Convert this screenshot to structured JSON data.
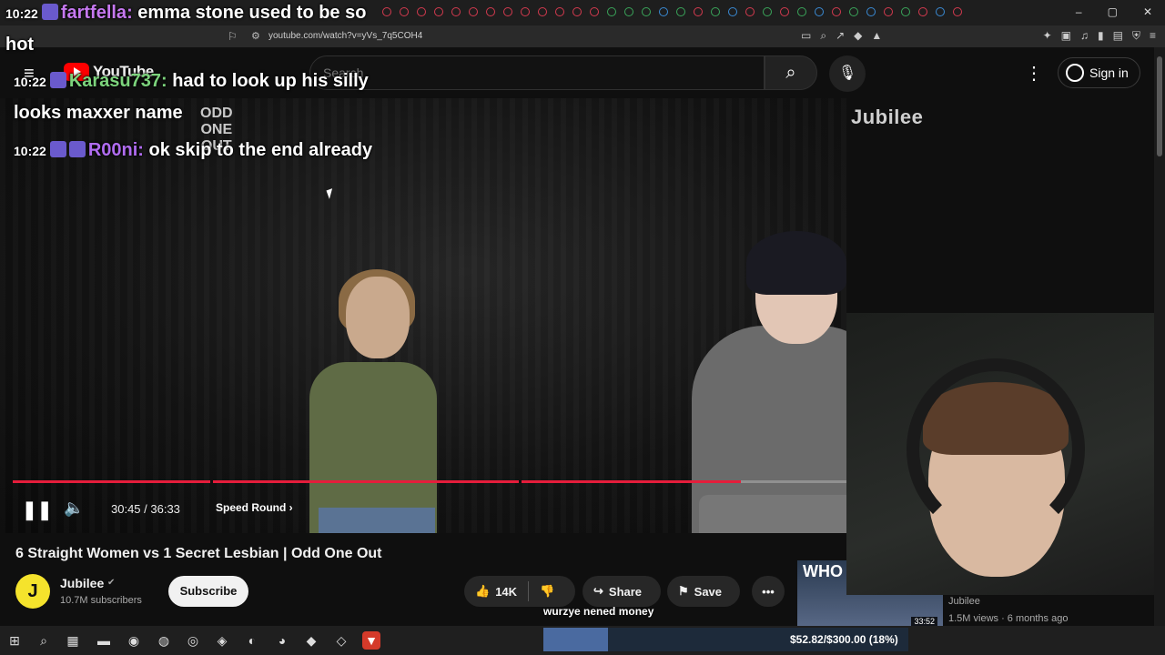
{
  "browser": {
    "url": "youtube.com/watch?v=yVs_7q5COH4"
  },
  "header": {
    "logo_text": "YouTube",
    "search_placeholder": "Search",
    "signin_label": "Sign in"
  },
  "video": {
    "watermark": "Jubilee",
    "current_time": "30:45",
    "duration": "36:33",
    "time_display": "30:45 / 36:33",
    "chapter": "Speed Round",
    "progress_fraction": 0.842,
    "chapter_boundaries": [
      0.228,
      0.585
    ]
  },
  "overlay_logo": {
    "line1": "ODD",
    "line2": "ONE",
    "line3": "OUT"
  },
  "info": {
    "title": "6 Straight Women vs 1 Secret Lesbian | Odd One Out",
    "channel_avatar_letter": "J",
    "channel_name": "Jubilee",
    "subscribers": "10.7M subscribers",
    "subscribe_label": "Subscribe",
    "likes": "14K",
    "share_label": "Share",
    "save_label": "Save"
  },
  "recommended": {
    "thumb_text": "WHO",
    "duration": "33:52",
    "channel": "Jubilee",
    "meta": "1.5M views · 6 months ago"
  },
  "chat": {
    "messages": [
      {
        "time": "10:22",
        "user": "fartfella",
        "text": "emma stone used to be so hot"
      },
      {
        "time": "10:22",
        "user": "Karasu737",
        "text": "had to look up his silly looks maxxer name"
      },
      {
        "time": "10:22",
        "user": "R00ni",
        "text": "ok skip to the end already"
      }
    ]
  },
  "stream": {
    "donation_text": "wurzye nened money",
    "goal_text": "$52.82/$300.00 (18%)",
    "goal_fraction": 0.176
  },
  "colors": {
    "accent_red": "#ff0000",
    "progress_red": "#e51d3b",
    "background": "#0f0f0f"
  }
}
